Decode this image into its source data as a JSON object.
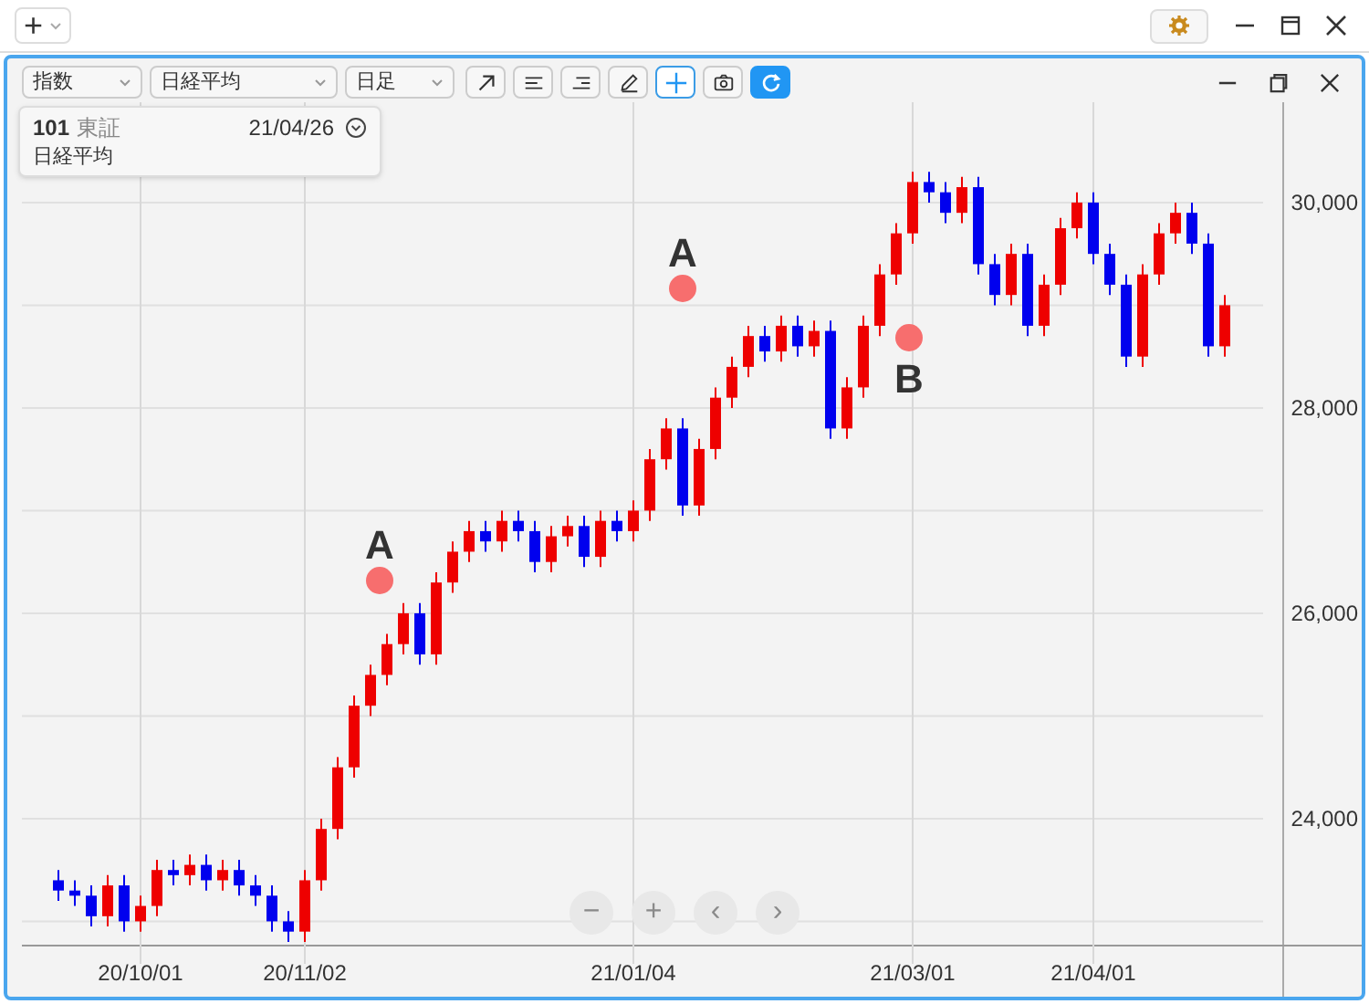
{
  "top_bar": {
    "add_button": "+"
  },
  "toolbar": {
    "dropdowns": [
      {
        "value": "指数"
      },
      {
        "value": "日経平均"
      },
      {
        "value": "日足"
      }
    ],
    "tools": [
      {
        "kind": "trend",
        "selected": false
      },
      {
        "kind": "align-left",
        "selected": false
      },
      {
        "kind": "align-right",
        "selected": false
      },
      {
        "kind": "pencil",
        "selected": false
      },
      {
        "kind": "crosshair",
        "selected": true
      },
      {
        "kind": "camera",
        "selected": false
      },
      {
        "kind": "refresh",
        "selected": false
      }
    ]
  },
  "legend": {
    "code": "101",
    "exchange": "東証",
    "date": "21/04/26",
    "name": "日経平均"
  },
  "nav_buttons": [
    "−",
    "+",
    "‹",
    "›"
  ],
  "chart_data": {
    "type": "candlestick",
    "categories": [
      null,
      null,
      null,
      null,
      null,
      "20/10/01",
      null,
      null,
      null,
      null,
      null,
      null,
      null,
      null,
      null,
      "20/11/02",
      null,
      null,
      null,
      null,
      null,
      null,
      null,
      null,
      null,
      null,
      null,
      null,
      null,
      null,
      null,
      null,
      null,
      null,
      null,
      "21/01/04",
      null,
      null,
      null,
      null,
      null,
      null,
      null,
      null,
      null,
      null,
      null,
      null,
      null,
      null,
      null,
      null,
      "21/03/01",
      null,
      null,
      null,
      null,
      null,
      null,
      null,
      null,
      null,
      null,
      "21/04/01",
      null,
      null,
      null,
      null,
      null,
      null,
      null,
      null
    ],
    "ohlc": [
      [
        23400,
        23500,
        23200,
        23300
      ],
      [
        23300,
        23400,
        23150,
        23250
      ],
      [
        23250,
        23350,
        22950,
        23050
      ],
      [
        23050,
        23450,
        22950,
        23350
      ],
      [
        23350,
        23450,
        22900,
        23000
      ],
      [
        23000,
        23250,
        22900,
        23150
      ],
      [
        23150,
        23600,
        23050,
        23500
      ],
      [
        23500,
        23600,
        23350,
        23450
      ],
      [
        23450,
        23650,
        23350,
        23550
      ],
      [
        23550,
        23650,
        23300,
        23400
      ],
      [
        23400,
        23600,
        23300,
        23500
      ],
      [
        23500,
        23600,
        23250,
        23350
      ],
      [
        23350,
        23450,
        23150,
        23250
      ],
      [
        23250,
        23350,
        22900,
        23000
      ],
      [
        23000,
        23100,
        22800,
        22900
      ],
      [
        22900,
        23500,
        22800,
        23400
      ],
      [
        23400,
        24000,
        23300,
        23900
      ],
      [
        23900,
        24600,
        23800,
        24500
      ],
      [
        24500,
        25200,
        24400,
        25100
      ],
      [
        25100,
        25500,
        25000,
        25400
      ],
      [
        25400,
        25800,
        25300,
        25700
      ],
      [
        25700,
        26100,
        25600,
        26000
      ],
      [
        26000,
        26100,
        25500,
        25600
      ],
      [
        25600,
        26400,
        25500,
        26300
      ],
      [
        26300,
        26700,
        26200,
        26600
      ],
      [
        26600,
        26900,
        26500,
        26800
      ],
      [
        26800,
        26900,
        26600,
        26700
      ],
      [
        26700,
        27000,
        26600,
        26900
      ],
      [
        26900,
        27000,
        26700,
        26800
      ],
      [
        26800,
        26900,
        26400,
        26500
      ],
      [
        26500,
        26850,
        26400,
        26750
      ],
      [
        26750,
        26950,
        26650,
        26850
      ],
      [
        26850,
        26950,
        26450,
        26550
      ],
      [
        26550,
        27000,
        26450,
        26900
      ],
      [
        26900,
        27000,
        26700,
        26800
      ],
      [
        26800,
        27100,
        26700,
        27000
      ],
      [
        27000,
        27600,
        26900,
        27500
      ],
      [
        27500,
        27900,
        27400,
        27800
      ],
      [
        27800,
        27900,
        26950,
        27050
      ],
      [
        27050,
        27700,
        26950,
        27600
      ],
      [
        27600,
        28200,
        27500,
        28100
      ],
      [
        28100,
        28500,
        28000,
        28400
      ],
      [
        28400,
        28800,
        28300,
        28700
      ],
      [
        28700,
        28800,
        28450,
        28550
      ],
      [
        28550,
        28900,
        28450,
        28800
      ],
      [
        28800,
        28900,
        28500,
        28600
      ],
      [
        28600,
        28850,
        28500,
        28750
      ],
      [
        28750,
        28850,
        27700,
        27800
      ],
      [
        27800,
        28300,
        27700,
        28200
      ],
      [
        28200,
        28900,
        28100,
        28800
      ],
      [
        28800,
        29400,
        28700,
        29300
      ],
      [
        29300,
        29800,
        29200,
        29700
      ],
      [
        29700,
        30300,
        29600,
        30200
      ],
      [
        30200,
        30300,
        30000,
        30100
      ],
      [
        30100,
        30200,
        29800,
        29900
      ],
      [
        29900,
        30250,
        29800,
        30150
      ],
      [
        30150,
        30250,
        29300,
        29400
      ],
      [
        29400,
        29500,
        29000,
        29100
      ],
      [
        29100,
        29600,
        29000,
        29500
      ],
      [
        29500,
        29600,
        28700,
        28800
      ],
      [
        28800,
        29300,
        28700,
        29200
      ],
      [
        29200,
        29850,
        29100,
        29750
      ],
      [
        29750,
        30100,
        29650,
        30000
      ],
      [
        30000,
        30100,
        29400,
        29500
      ],
      [
        29500,
        29600,
        29100,
        29200
      ],
      [
        29200,
        29300,
        28400,
        28500
      ],
      [
        28500,
        29400,
        28400,
        29300
      ],
      [
        29300,
        29800,
        29200,
        29700
      ],
      [
        29700,
        30000,
        29600,
        29900
      ],
      [
        29900,
        30000,
        29500,
        29600
      ],
      [
        29600,
        29700,
        28500,
        28600
      ],
      [
        28600,
        29100,
        28500,
        29000
      ]
    ],
    "yticks": [
      {
        "value": 24000,
        "label": "24,000"
      },
      {
        "value": 26000,
        "label": "26,000"
      },
      {
        "value": 28000,
        "label": "28,000"
      },
      {
        "value": 30000,
        "label": "30,000"
      }
    ],
    "ylim": [
      22764,
      30977
    ],
    "grid": true,
    "annotations": [
      "A",
      "A",
      "B"
    ]
  }
}
